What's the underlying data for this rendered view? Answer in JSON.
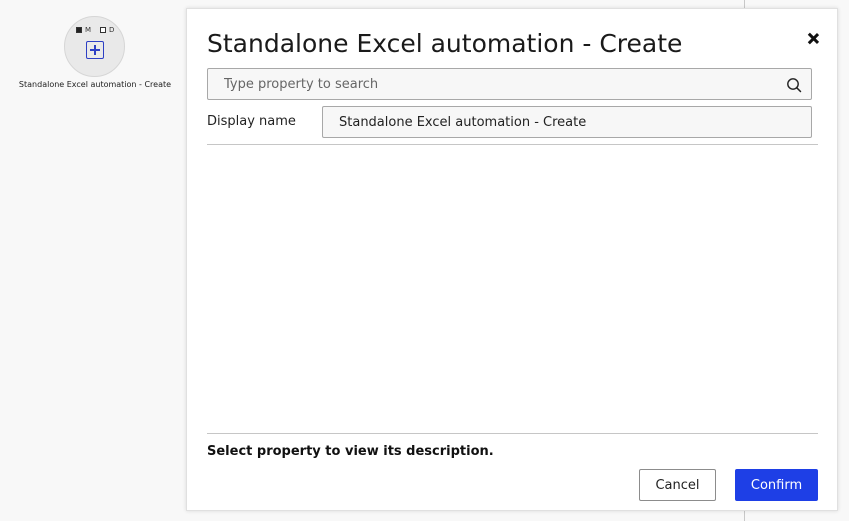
{
  "canvas": {
    "node": {
      "flag_m": "M",
      "flag_d": "D",
      "flag_m_checked": true,
      "flag_d_checked": false,
      "icon": "add-square-icon",
      "label": "Standalone Excel automation - Create"
    }
  },
  "dialog": {
    "title": "Standalone Excel automation - Create",
    "close_icon": "close-icon",
    "search": {
      "placeholder": "Type property to search",
      "value": "",
      "icon": "search-icon"
    },
    "display_name": {
      "label": "Display name",
      "value": "Standalone Excel automation - Create"
    },
    "description_text": "Select property to view its description.",
    "buttons": {
      "cancel_label": "Cancel",
      "confirm_label": "Confirm"
    },
    "colors": {
      "confirm_bg": "#1e3fe6",
      "accent_icon": "#2d3fc4"
    }
  }
}
